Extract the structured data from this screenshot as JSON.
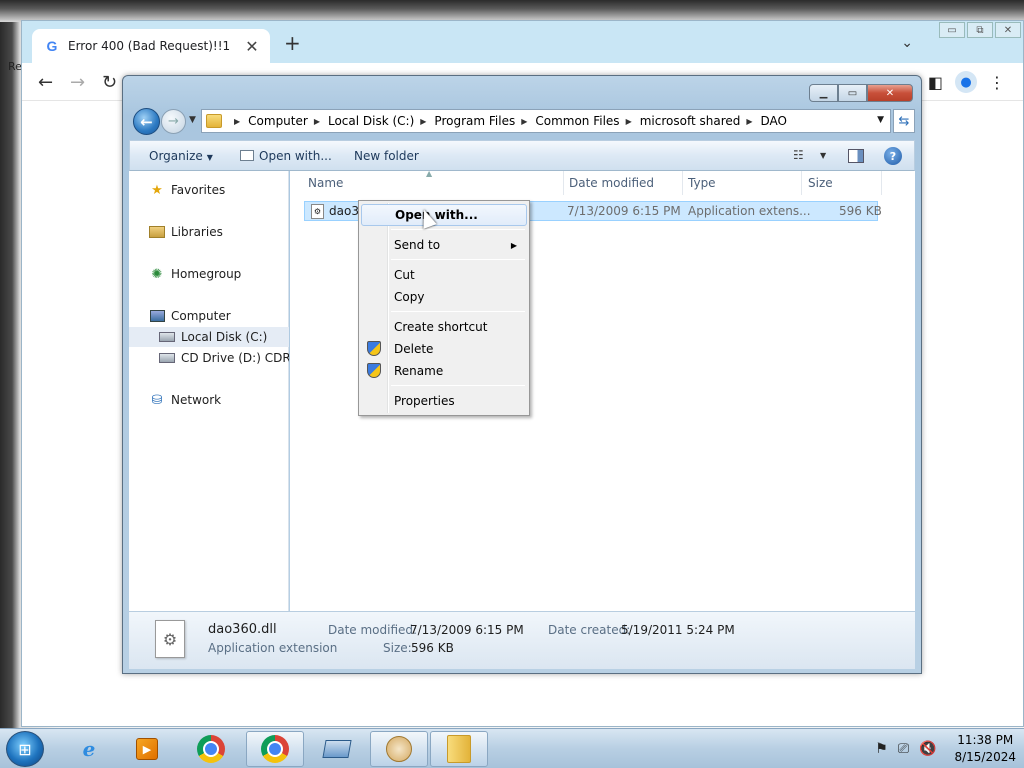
{
  "desktop": {
    "left_label": "Re"
  },
  "browser": {
    "tab_title": "Error 400 (Bad Request)!!1",
    "tab_close": "✕",
    "new_tab": "+",
    "tab_list": "⌄",
    "win_min": "▭",
    "win_max": "⧉",
    "win_close": "✕",
    "back": "←",
    "forward": "→",
    "reload": "↻"
  },
  "explorer": {
    "address": {
      "crumbs": [
        "Computer",
        "Local Disk (C:)",
        "Program Files",
        "Common Files",
        "microsoft shared",
        "DAO"
      ]
    },
    "command_bar": {
      "organize": "Organize",
      "open_with": "Open with...",
      "new_folder": "New folder"
    },
    "nav": {
      "favorites": "Favorites",
      "libraries": "Libraries",
      "homegroup": "Homegroup",
      "computer": "Computer",
      "local_disk": "Local Disk (C:)",
      "cd_drive": "CD Drive (D:) CDROM",
      "network": "Network"
    },
    "columns": {
      "name": "Name",
      "date_modified": "Date modified",
      "type": "Type",
      "size": "Size"
    },
    "file": {
      "name": "dao36",
      "date_modified": "7/13/2009 6:15 PM",
      "type": "Application extens...",
      "size": "596 KB"
    },
    "details": {
      "filename": "dao360.dll",
      "filetype": "Application extension",
      "date_modified_label": "Date modified:",
      "date_modified": "7/13/2009 6:15 PM",
      "size_label": "Size:",
      "size": "596 KB",
      "date_created_label": "Date created:",
      "date_created": "5/19/2011 5:24 PM"
    }
  },
  "context_menu": {
    "open_with": "Open with...",
    "send_to": "Send to",
    "cut": "Cut",
    "copy": "Copy",
    "create_shortcut": "Create shortcut",
    "delete": "Delete",
    "rename": "Rename",
    "properties": "Properties"
  },
  "taskbar": {
    "time": "11:38 PM",
    "date": "8/15/2024"
  },
  "icons": {
    "favorites": "star-icon",
    "libraries": "libraries-icon",
    "homegroup": "homegroup-icon",
    "computer": "computer-icon",
    "network": "network-icon",
    "shield": "uac-shield-icon"
  }
}
